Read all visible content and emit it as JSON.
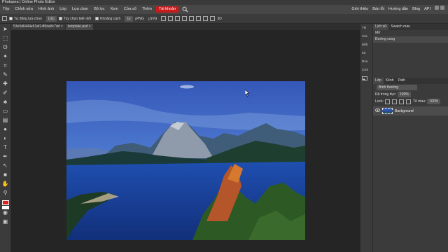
{
  "app": {
    "title": "Photopea | Online Photo Editor"
  },
  "menu": {
    "items": [
      "Tệp",
      "Chỉnh sửa",
      "Hình ảnh",
      "Lớp",
      "Lựa chọn",
      "Bộ lọc",
      "Xem",
      "Cửa sổ",
      "Thêm"
    ],
    "account": "Tài khoản",
    "right": [
      "Giới thiệu",
      "Báo lỗi",
      "Hướng dẫn",
      "Blog",
      "API"
    ]
  },
  "options": {
    "auto_select": "Tự động lựa chọn",
    "layer_select": "Lớp",
    "transform": "Tùy chọn biến đổi",
    "distances": "Khoảng cách",
    "zoom": "1x",
    "png": "PNG",
    "svg": "SVG",
    "mode_3d": "3D"
  },
  "tabs": [
    {
      "label": "53e5d6444e53af14f6da8c7dd ×"
    },
    {
      "label": "template.psd ×"
    }
  ],
  "minibar": [
    "Thi",
    "Các",
    "Nếb",
    "Kit",
    "Đoa",
    "CSS",
    ""
  ],
  "history": {
    "tabs": [
      "Lịch sử",
      "Swatch màu"
    ],
    "items": [
      "Mở",
      "Đường cong"
    ]
  },
  "layers": {
    "tabs": [
      "Lớp",
      "Kênh",
      "Path"
    ],
    "blend": "Bình thường",
    "opacity_label": "Độ trong đục:",
    "opacity_value": "100%",
    "lock_label": "Lock:",
    "fill_label": "Tô màu:",
    "fill_value": "100%",
    "items": [
      {
        "name": "Background"
      }
    ]
  },
  "colors": {
    "accent": "#c81b1b",
    "foreground": "#e02020",
    "background": "#ffffff"
  }
}
